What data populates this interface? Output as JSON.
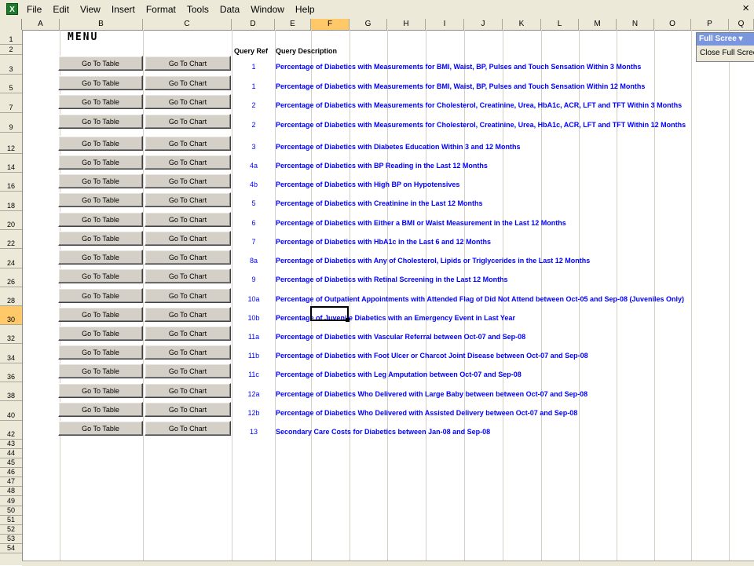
{
  "menu": {
    "items": [
      "File",
      "Edit",
      "View",
      "Insert",
      "Format",
      "Tools",
      "Data",
      "Window",
      "Help"
    ]
  },
  "window": {
    "close_glyph": "×"
  },
  "columns": [
    "A",
    "B",
    "C",
    "D",
    "E",
    "F",
    "G",
    "H",
    "I",
    "J",
    "K",
    "L",
    "M",
    "N",
    "O",
    "P",
    "Q"
  ],
  "active_column": "F",
  "active_row": "30",
  "row_labels": [
    "1",
    "2",
    "3",
    "5",
    "7",
    "9",
    "12",
    "14",
    "16",
    "18",
    "20",
    "22",
    "24",
    "26",
    "28",
    "30",
    "32",
    "34",
    "36",
    "38",
    "40",
    "42",
    "43",
    "44",
    "45",
    "46",
    "47",
    "48",
    "49",
    "50",
    "51",
    "52",
    "53",
    "54"
  ],
  "sheet": {
    "title": "MENU",
    "header_ref": "Query Ref",
    "header_desc": "Query Description",
    "button_table": "Go To Table",
    "button_chart": "Go To Chart"
  },
  "queries": [
    {
      "ref": "1",
      "desc": "Percentage of Diabetics with Measurements for BMI, Waist, BP, Pulses and Touch Sensation Within 3 Months"
    },
    {
      "ref": "1",
      "desc": "Percentage of Diabetics with Measurements for BMI, Waist, BP, Pulses and Touch Sensation Within 12 Months"
    },
    {
      "ref": "2",
      "desc": "Percentage of Diabetics with Measurements for Cholesterol, Creatinine, Urea, HbA1c, ACR, LFT and TFT Within 3 Months"
    },
    {
      "ref": "2",
      "desc": "Percentage of Diabetics with Measurements for Cholesterol, Creatinine, Urea, HbA1c, ACR, LFT and TFT Within 12 Months"
    },
    {
      "ref": "3",
      "desc": "Percentage of Diabetics with Diabetes Education Within 3 and 12 Months"
    },
    {
      "ref": "4a",
      "desc": "Percentage of Diabetics with BP Reading in the Last 12 Months"
    },
    {
      "ref": "4b",
      "desc": "Percentage of Diabetics with High BP on Hypotensives"
    },
    {
      "ref": "5",
      "desc": "Percentage of Diabetics with Creatinine in the Last 12 Months"
    },
    {
      "ref": "6",
      "desc": "Percentage of Diabetics with Either a BMI or Waist Measurement in the Last 12 Months"
    },
    {
      "ref": "7",
      "desc": "Percentage of Diabetics with HbA1c in the Last 6 and 12 Months"
    },
    {
      "ref": "8a",
      "desc": "Percentage of Diabetics with Any of Cholesterol, Lipids or Triglycerides in the Last 12 Months"
    },
    {
      "ref": "9",
      "desc": "Percentage of Diabetics with Retinal Screening in the Last 12 Months"
    },
    {
      "ref": "10a",
      "desc": "Percentage of Outpatient Appointments with Attended Flag of Did Not Attend between Oct-05 and Sep-08 (Juveniles Only)"
    },
    {
      "ref": "10b",
      "desc": "Percentage of Juvenile Diabetics with an Emergency Event in Last Year"
    },
    {
      "ref": "11a",
      "desc": "Percentage of Diabetics with Vascular Referral between Oct-07 and Sep-08"
    },
    {
      "ref": "11b",
      "desc": "Percentage of Diabetics with Foot Ulcer or Charcot Joint Disease between Oct-07 and Sep-08"
    },
    {
      "ref": "11c",
      "desc": "Percentage of Diabetics with Leg Amputation between Oct-07 and Sep-08"
    },
    {
      "ref": "12a",
      "desc": "Percentage of Diabetics Who Delivered with Large Baby between between Oct-07 and Sep-08"
    },
    {
      "ref": "12b",
      "desc": "Percentage of Diabetics Who Delivered with Assisted Delivery between Oct-07 and Sep-08"
    },
    {
      "ref": "13",
      "desc": "Secondary Care Costs for Diabetics between Jan-08 and Sep-08"
    }
  ],
  "toolbar": {
    "title": "Full Scree ▾",
    "close_label": "Close Full Scree"
  }
}
